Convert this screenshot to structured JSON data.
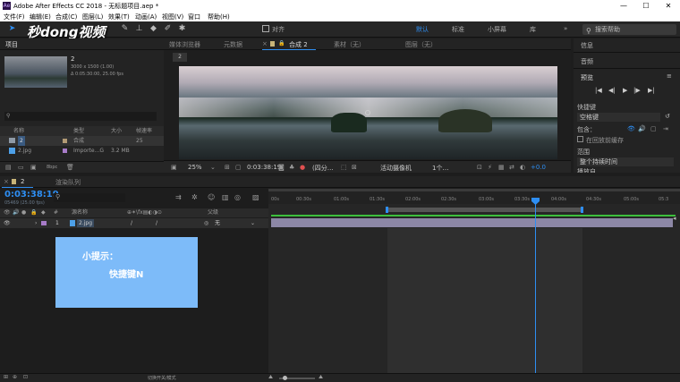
{
  "window": {
    "title": "Adobe After Effects CC 2018 - 无标题项目.aep *",
    "app_icon": "Ae",
    "min": "—",
    "max": "☐",
    "close": "✕"
  },
  "menu": [
    "文件(F)",
    "编辑(E)",
    "合成(C)",
    "图层(L)",
    "效果(T)",
    "动画(A)",
    "视图(V)",
    "窗口",
    "帮助(H)"
  ],
  "toolbar": {
    "align_label": "对齐",
    "workspaces": [
      "默认",
      "标准",
      "小屏幕",
      "库"
    ],
    "more": "»",
    "search_placeholder": "搜索帮助"
  },
  "watermark": "秒dong视频",
  "project": {
    "tab": "项目",
    "item_name": "2",
    "item_info1": "3000 x 1500 (1.00)",
    "item_info2": "Δ 0:05:30:00, 25.00 fps",
    "search_placeholder": "",
    "columns": [
      "名称",
      "类型",
      "大小",
      "帧速率"
    ],
    "rows": [
      {
        "name": "2",
        "type": "合成",
        "size": "",
        "fps": "25"
      },
      {
        "name": "2.jpg",
        "type": "Importe...G",
        "size": "3.2 MB",
        "fps": ""
      }
    ],
    "bpc": "8bpc"
  },
  "viewer": {
    "tabs": [
      "媒体浏览器",
      "元数据",
      "合成 2",
      "素材（无）",
      "图层（无）"
    ],
    "comp_chip": "2",
    "zoom": "25%",
    "time": "0:03:38:19",
    "quality": "(四分…",
    "camera": "活动摄像机",
    "views": "1个…",
    "exposure": "+0.0"
  },
  "right_panel": {
    "sections": [
      "信息",
      "音频",
      "预览"
    ],
    "preview_controls": [
      "|◀",
      "◀|",
      "▶",
      "|▶",
      "▶|"
    ],
    "shortcut_label": "快捷键",
    "shortcut_value": "空格键",
    "include_label": "包含：",
    "cache_label": "在回放前缓存",
    "range_label": "范围",
    "range_value": "整个持续时间",
    "playfrom_label": "播放自"
  },
  "timeline": {
    "tabs": [
      "2",
      "渲染队列"
    ],
    "current_time": "0:03:38:19",
    "frame_info": "05469 (25.00 fps)",
    "search_placeholder": "",
    "col_source": "源名称",
    "col_parent": "父级",
    "layer": {
      "number": "1",
      "name": "2.jpg",
      "parent": "无"
    },
    "ruler_labels": [
      "00s",
      "00:30s",
      "01:00s",
      "01:30s",
      "02:00s",
      "02:30s",
      "03:00s",
      "03:30s",
      "04:00s",
      "04:30s",
      "05:00s",
      "05:3"
    ],
    "footer_label": "切换开关/模式"
  },
  "tip": {
    "title": "小提示：",
    "body": "快捷键N"
  },
  "colors": {
    "accent": "#2e8ef2",
    "timeline_green": "#3cbf3c",
    "layer_bar": "#8c87a6",
    "tip_bg": "#7dbbf9"
  }
}
